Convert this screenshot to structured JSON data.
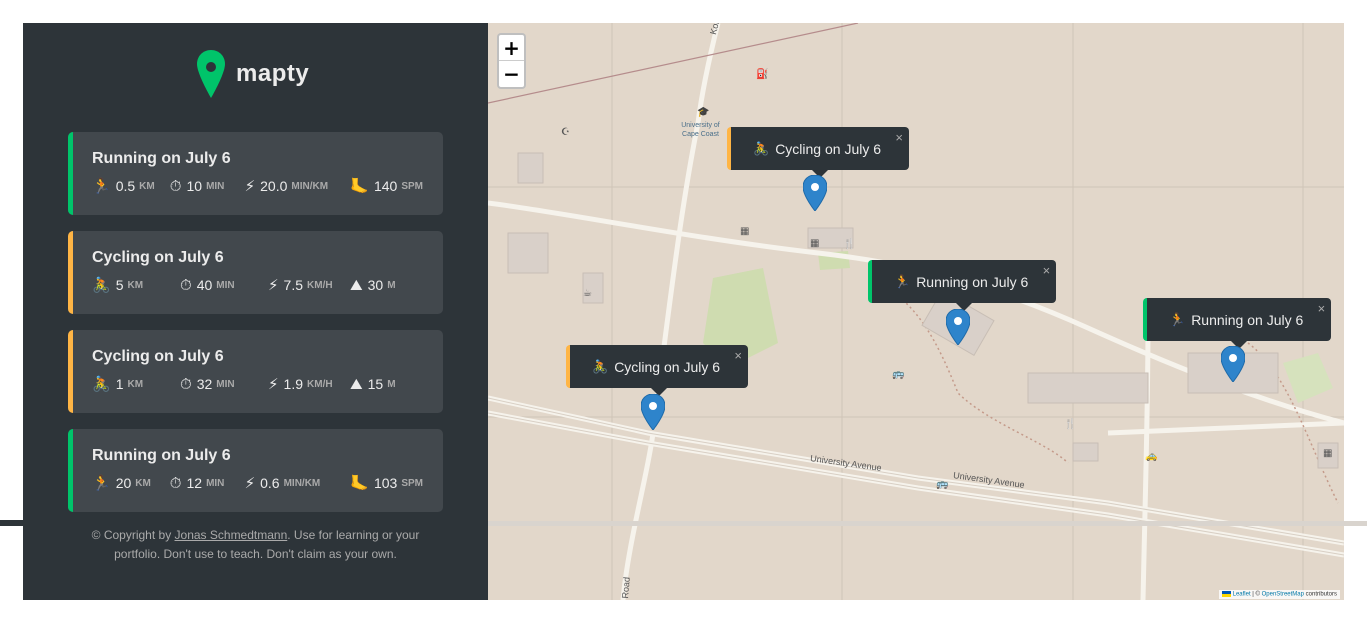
{
  "app": {
    "name": "mapty",
    "brand_color": "#00c46a",
    "cycling_color": "#ffb545",
    "sidebar_bg": "#2d3439",
    "card_bg": "#42484d"
  },
  "workouts": [
    {
      "type": "running",
      "title": "Running on July 6",
      "distance": "0.5",
      "distance_unit": "km",
      "duration": "10",
      "duration_unit": "min",
      "pace": "20.0",
      "pace_unit": "min/km",
      "cadence": "140",
      "cadence_unit": "spm"
    },
    {
      "type": "cycling",
      "title": "Cycling on July 6",
      "distance": "5",
      "distance_unit": "km",
      "duration": "40",
      "duration_unit": "min",
      "speed": "7.5",
      "speed_unit": "km/h",
      "elevation": "30",
      "elevation_unit": "m"
    },
    {
      "type": "cycling",
      "title": "Cycling on July 6",
      "distance": "1",
      "distance_unit": "km",
      "duration": "32",
      "duration_unit": "min",
      "speed": "1.9",
      "speed_unit": "km/h",
      "elevation": "15",
      "elevation_unit": "m"
    },
    {
      "type": "running",
      "title": "Running on July 6",
      "distance": "20",
      "distance_unit": "km",
      "duration": "12",
      "duration_unit": "min",
      "pace": "0.6",
      "pace_unit": "min/km",
      "cadence": "103",
      "cadence_unit": "spm"
    }
  ],
  "icons": {
    "running": "🏃",
    "cycling": "🚴",
    "duration": "⏱",
    "pace": "⚡",
    "cadence": "🦶",
    "elevation": "⛰"
  },
  "footer": {
    "prefix": "© Copyright by ",
    "author": "Jonas Schmedtmann",
    "suffix": ". Use for learning or your portfolio. Don't use to teach. Don't claim as your own."
  },
  "map": {
    "zoom_in": "+",
    "zoom_out": "−",
    "popups": [
      {
        "type": "cycling",
        "label": "Cycling on July 6",
        "close": "×"
      },
      {
        "type": "running",
        "label": "Running on July 6",
        "close": "×"
      },
      {
        "type": "running",
        "label": "Running on July 6",
        "close": "×"
      },
      {
        "type": "cycling",
        "label": "Cycling on July 6",
        "close": "×"
      }
    ],
    "labels": {
      "university": "University of Cape Coast",
      "road1": "Kobina Sekyi Road",
      "road2": "University Avenue",
      "road3": "University Avenue",
      "road4": "Road"
    },
    "attribution": {
      "leaflet": "Leaflet",
      "sep": " | © ",
      "osm": "OpenStreetMap",
      "suffix": " contributors"
    }
  }
}
